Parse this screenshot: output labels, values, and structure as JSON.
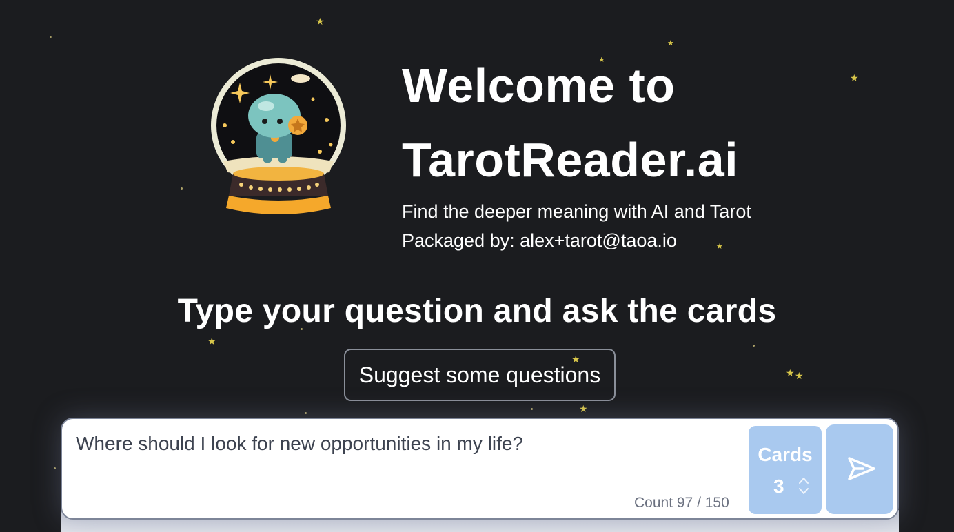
{
  "hero": {
    "title_line1": "Welcome to",
    "title_line2": "TarotReader.ai",
    "subtitle": "Find the deeper meaning with AI and Tarot",
    "packaged_by": "Packaged by: alex+tarot@taoa.io",
    "logo_icon": "crystal-ball-robot-icon"
  },
  "prompt": {
    "heading": "Type your question and ask the cards",
    "suggest_label": "Suggest some questions"
  },
  "input": {
    "question_value": "Where should I look for new opportunities in my life?",
    "count_text": "Count 97 / 150"
  },
  "cards": {
    "label": "Cards",
    "value": "3"
  },
  "send": {
    "icon": "send-icon"
  },
  "colors": {
    "background": "#1b1c1f",
    "accent": "#a9c9ef",
    "star": "#d8c64a"
  }
}
